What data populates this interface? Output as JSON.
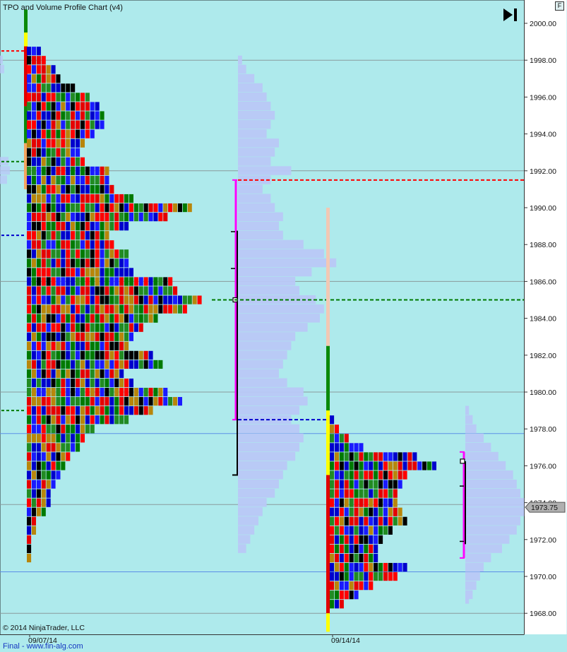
{
  "header": {
    "title": "TPO and Volume Profile Chart (v4)",
    "f_button": "F"
  },
  "footer": {
    "copyright": "© 2014 NinjaTrader, LLC",
    "link": "Final - www.fin-alg.com"
  },
  "icons": {
    "scroll_to_end": "skip-to-end-icon"
  },
  "colors": {
    "background": "#aeeaec",
    "volume_bar": "#b9c8f7",
    "value_area": "#ff00ff",
    "poc": "#007a00",
    "vah": "#ff0000",
    "val": "#0000cc",
    "tpo_palette": [
      "#e60000",
      "#0000cc",
      "#007a00",
      "#b8860b",
      "#000000",
      "#228b22",
      "#ff0000",
      "#1a1aff"
    ]
  },
  "chart_data": {
    "type": "tpo_volume_profile",
    "ylim": [
      1967.0,
      2001.0
    ],
    "yticks": [
      1968,
      1970,
      1972,
      1974,
      1976,
      1978,
      1980,
      1982,
      1984,
      1986,
      1988,
      1990,
      1992,
      1994,
      1996,
      1998,
      2000
    ],
    "ytick_labels": [
      "1968.00",
      "1970.00",
      "1972.00",
      "1974.00",
      "1976.00",
      "1978.00",
      "1980.00",
      "1982.00",
      "1984.00",
      "1986.00",
      "1988.00",
      "1990.00",
      "1992.00",
      "1994.00",
      "1996.00",
      "1998.00",
      "2000.00"
    ],
    "last_price": 1973.75,
    "last_price_label": "1973.75",
    "x_labels": [
      "09/07/14",
      "09/14/14"
    ],
    "reference_lines": {
      "gray": [
        1968.0,
        1973.9,
        1980.0,
        1986.0,
        1992.0,
        1998.0
      ],
      "blue": [
        1970.25,
        1977.75
      ]
    },
    "sessions": [
      {
        "label": "09/07/14",
        "low": 1971.0,
        "high": 1998.75,
        "poc": 1985.0,
        "vah": 1991.5,
        "val": 1978.5,
        "prev_vah": 1998.5,
        "prev_poc": 1992.5,
        "prev_val": 1988.5,
        "prev_low": 1979.0,
        "ib_high": 2000.75,
        "ib_low": 1993.5,
        "range_high": 1988.75,
        "range_low": 1975.5,
        "volume_profile_low": 1971.5,
        "volume_profile_high": 1998.0,
        "tpo_widths": [
          {
            "p": 1971.0,
            "n": 1
          },
          {
            "p": 1971.5,
            "n": 1
          },
          {
            "p": 1972.0,
            "n": 1
          },
          {
            "p": 1972.5,
            "n": 2
          },
          {
            "p": 1973.0,
            "n": 2
          },
          {
            "p": 1973.5,
            "n": 4
          },
          {
            "p": 1974.0,
            "n": 5
          },
          {
            "p": 1974.5,
            "n": 5
          },
          {
            "p": 1975.0,
            "n": 6
          },
          {
            "p": 1975.5,
            "n": 7
          },
          {
            "p": 1976.0,
            "n": 8
          },
          {
            "p": 1976.5,
            "n": 9
          },
          {
            "p": 1977.0,
            "n": 11
          },
          {
            "p": 1977.5,
            "n": 12
          },
          {
            "p": 1978.0,
            "n": 14
          },
          {
            "p": 1978.5,
            "n": 21
          },
          {
            "p": 1979.0,
            "n": 26
          },
          {
            "p": 1979.5,
            "n": 32
          },
          {
            "p": 1980.0,
            "n": 29
          },
          {
            "p": 1980.5,
            "n": 22
          },
          {
            "p": 1981.0,
            "n": 20
          },
          {
            "p": 1981.5,
            "n": 28
          },
          {
            "p": 1982.0,
            "n": 26
          },
          {
            "p": 1982.5,
            "n": 21
          },
          {
            "p": 1983.0,
            "n": 22
          },
          {
            "p": 1983.5,
            "n": 24
          },
          {
            "p": 1984.0,
            "n": 27
          },
          {
            "p": 1984.5,
            "n": 33
          },
          {
            "p": 1985.0,
            "n": 36
          },
          {
            "p": 1985.5,
            "n": 31
          },
          {
            "p": 1986.0,
            "n": 30
          },
          {
            "p": 1986.5,
            "n": 22
          },
          {
            "p": 1987.0,
            "n": 21
          },
          {
            "p": 1987.5,
            "n": 21
          },
          {
            "p": 1988.0,
            "n": 18
          },
          {
            "p": 1988.5,
            "n": 17
          },
          {
            "p": 1989.0,
            "n": 21
          },
          {
            "p": 1989.5,
            "n": 29
          },
          {
            "p": 1990.0,
            "n": 34
          },
          {
            "p": 1990.5,
            "n": 22
          },
          {
            "p": 1991.0,
            "n": 18
          },
          {
            "p": 1991.5,
            "n": 17
          },
          {
            "p": 1992.0,
            "n": 17
          },
          {
            "p": 1992.5,
            "n": 12
          },
          {
            "p": 1993.0,
            "n": 11
          },
          {
            "p": 1993.5,
            "n": 12
          },
          {
            "p": 1994.0,
            "n": 14
          },
          {
            "p": 1994.5,
            "n": 16
          },
          {
            "p": 1995.0,
            "n": 16
          },
          {
            "p": 1995.5,
            "n": 15
          },
          {
            "p": 1996.0,
            "n": 13
          },
          {
            "p": 1996.5,
            "n": 10
          },
          {
            "p": 1997.0,
            "n": 7
          },
          {
            "p": 1997.5,
            "n": 6
          },
          {
            "p": 1998.0,
            "n": 4
          },
          {
            "p": 1998.5,
            "n": 3
          }
        ],
        "volume_widths": [
          {
            "p": 1971.5,
            "v": 2
          },
          {
            "p": 1972.0,
            "v": 3
          },
          {
            "p": 1972.5,
            "v": 4
          },
          {
            "p": 1973.0,
            "v": 5
          },
          {
            "p": 1973.5,
            "v": 6
          },
          {
            "p": 1974.0,
            "v": 7
          },
          {
            "p": 1974.5,
            "v": 9
          },
          {
            "p": 1975.0,
            "v": 10
          },
          {
            "p": 1975.5,
            "v": 11
          },
          {
            "p": 1976.0,
            "v": 12
          },
          {
            "p": 1976.5,
            "v": 14
          },
          {
            "p": 1977.0,
            "v": 15
          },
          {
            "p": 1977.5,
            "v": 16
          },
          {
            "p": 1978.0,
            "v": 15
          },
          {
            "p": 1978.5,
            "v": 13
          },
          {
            "p": 1979.0,
            "v": 15
          },
          {
            "p": 1979.5,
            "v": 17
          },
          {
            "p": 1980.0,
            "v": 16
          },
          {
            "p": 1980.5,
            "v": 12
          },
          {
            "p": 1981.0,
            "v": 10
          },
          {
            "p": 1981.5,
            "v": 11
          },
          {
            "p": 1982.0,
            "v": 12
          },
          {
            "p": 1982.5,
            "v": 13
          },
          {
            "p": 1983.0,
            "v": 14
          },
          {
            "p": 1983.5,
            "v": 17
          },
          {
            "p": 1984.0,
            "v": 20
          },
          {
            "p": 1984.5,
            "v": 21
          },
          {
            "p": 1985.0,
            "v": 19
          },
          {
            "p": 1985.5,
            "v": 15
          },
          {
            "p": 1986.0,
            "v": 14
          },
          {
            "p": 1986.5,
            "v": 18
          },
          {
            "p": 1987.0,
            "v": 24
          },
          {
            "p": 1987.5,
            "v": 21
          },
          {
            "p": 1988.0,
            "v": 16
          },
          {
            "p": 1988.5,
            "v": 11
          },
          {
            "p": 1989.0,
            "v": 10
          },
          {
            "p": 1989.5,
            "v": 11
          },
          {
            "p": 1990.0,
            "v": 9
          },
          {
            "p": 1990.5,
            "v": 8
          },
          {
            "p": 1991.0,
            "v": 6
          },
          {
            "p": 1991.5,
            "v": 8
          },
          {
            "p": 1992.0,
            "v": 13
          },
          {
            "p": 1992.5,
            "v": 8
          },
          {
            "p": 1993.0,
            "v": 9
          },
          {
            "p": 1993.5,
            "v": 10
          },
          {
            "p": 1994.0,
            "v": 7
          },
          {
            "p": 1994.5,
            "v": 8
          },
          {
            "p": 1995.0,
            "v": 9
          },
          {
            "p": 1995.5,
            "v": 8
          },
          {
            "p": 1996.0,
            "v": 7
          },
          {
            "p": 1996.5,
            "v": 6
          },
          {
            "p": 1997.0,
            "v": 4
          },
          {
            "p": 1997.5,
            "v": 2
          },
          {
            "p": 1998.0,
            "v": 1
          }
        ]
      },
      {
        "label": "09/14/14",
        "low": 1968.5,
        "high": 1978.75,
        "poc": 1985.0,
        "vah": 1991.5,
        "val": 1978.5,
        "ib_high": 1979.0,
        "ib_low": 1967.0,
        "range_high": 1976.75,
        "range_low": 1971.0,
        "volume_profile_low": 1968.75,
        "volume_profile_high": 1979.0,
        "tpo_widths": [
          {
            "p": 1968.5,
            "n": 3
          },
          {
            "p": 1969.0,
            "n": 6
          },
          {
            "p": 1969.5,
            "n": 9
          },
          {
            "p": 1970.0,
            "n": 14
          },
          {
            "p": 1970.5,
            "n": 16
          },
          {
            "p": 1971.0,
            "n": 10
          },
          {
            "p": 1971.5,
            "n": 10
          },
          {
            "p": 1972.0,
            "n": 11
          },
          {
            "p": 1972.5,
            "n": 13
          },
          {
            "p": 1973.0,
            "n": 16
          },
          {
            "p": 1973.5,
            "n": 15
          },
          {
            "p": 1974.0,
            "n": 14
          },
          {
            "p": 1974.5,
            "n": 14
          },
          {
            "p": 1975.0,
            "n": 15
          },
          {
            "p": 1975.5,
            "n": 16
          },
          {
            "p": 1976.0,
            "n": 22
          },
          {
            "p": 1976.5,
            "n": 18
          },
          {
            "p": 1977.0,
            "n": 7
          },
          {
            "p": 1977.5,
            "n": 4
          },
          {
            "p": 1978.0,
            "n": 2
          },
          {
            "p": 1978.5,
            "n": 1
          }
        ],
        "volume_widths": [
          {
            "p": 1968.75,
            "v": 1
          },
          {
            "p": 1969.0,
            "v": 2
          },
          {
            "p": 1969.5,
            "v": 3
          },
          {
            "p": 1970.0,
            "v": 4
          },
          {
            "p": 1970.5,
            "v": 5
          },
          {
            "p": 1971.0,
            "v": 7
          },
          {
            "p": 1971.5,
            "v": 10
          },
          {
            "p": 1972.0,
            "v": 12
          },
          {
            "p": 1972.5,
            "v": 14
          },
          {
            "p": 1973.0,
            "v": 15
          },
          {
            "p": 1973.5,
            "v": 16
          },
          {
            "p": 1974.0,
            "v": 16
          },
          {
            "p": 1974.5,
            "v": 15
          },
          {
            "p": 1975.0,
            "v": 14
          },
          {
            "p": 1975.5,
            "v": 13
          },
          {
            "p": 1976.0,
            "v": 11
          },
          {
            "p": 1976.5,
            "v": 9
          },
          {
            "p": 1977.0,
            "v": 7
          },
          {
            "p": 1977.5,
            "v": 5
          },
          {
            "p": 1978.0,
            "v": 3
          },
          {
            "p": 1978.5,
            "v": 2
          },
          {
            "p": 1979.0,
            "v": 1
          }
        ]
      }
    ]
  }
}
